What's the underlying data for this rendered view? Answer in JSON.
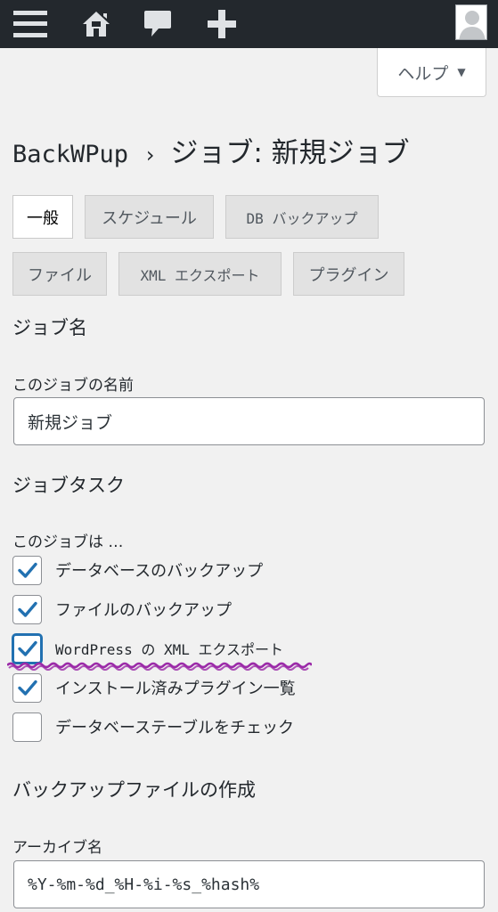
{
  "adminbar": {
    "icons": [
      "menu-icon",
      "home-icon",
      "comment-icon",
      "plus-icon",
      "avatar-icon"
    ]
  },
  "help": {
    "label": "ヘルプ",
    "arrow": "▼"
  },
  "title": {
    "plugin": "BackWPup",
    "separator": "›",
    "page": "ジョブ: 新規ジョブ"
  },
  "tabs": [
    {
      "label": "一般",
      "active": true
    },
    {
      "label": "スケジュール",
      "active": false
    },
    {
      "label": "DB バックアップ",
      "active": false
    },
    {
      "label": "ファイル",
      "active": false
    },
    {
      "label": "XML エクスポート",
      "active": false
    },
    {
      "label": "プラグイン",
      "active": false
    }
  ],
  "job_name_section": {
    "heading": "ジョブ名",
    "field_label": "このジョブの名前",
    "value": "新規ジョブ"
  },
  "job_tasks_section": {
    "heading": "ジョブタスク",
    "intro": "このジョブは …",
    "tasks": [
      {
        "label": "データベースのバックアップ",
        "checked": true
      },
      {
        "label": "ファイルのバックアップ",
        "checked": true
      },
      {
        "label": "WordPress の XML エクスポート",
        "checked": true
      },
      {
        "label": "インストール済みプラグイン一覧",
        "checked": true
      },
      {
        "label": "データベーステーブルをチェック",
        "checked": false
      }
    ]
  },
  "archive_section": {
    "heading": "バックアップファイルの作成",
    "field_label": "アーカイブ名",
    "value": "%Y-%m-%d_%H-%i-%s_%hash%"
  },
  "colors": {
    "adminbar_bg": "#23282d",
    "checkmark": "#2271b1",
    "annotation": "#9b2aa8"
  }
}
